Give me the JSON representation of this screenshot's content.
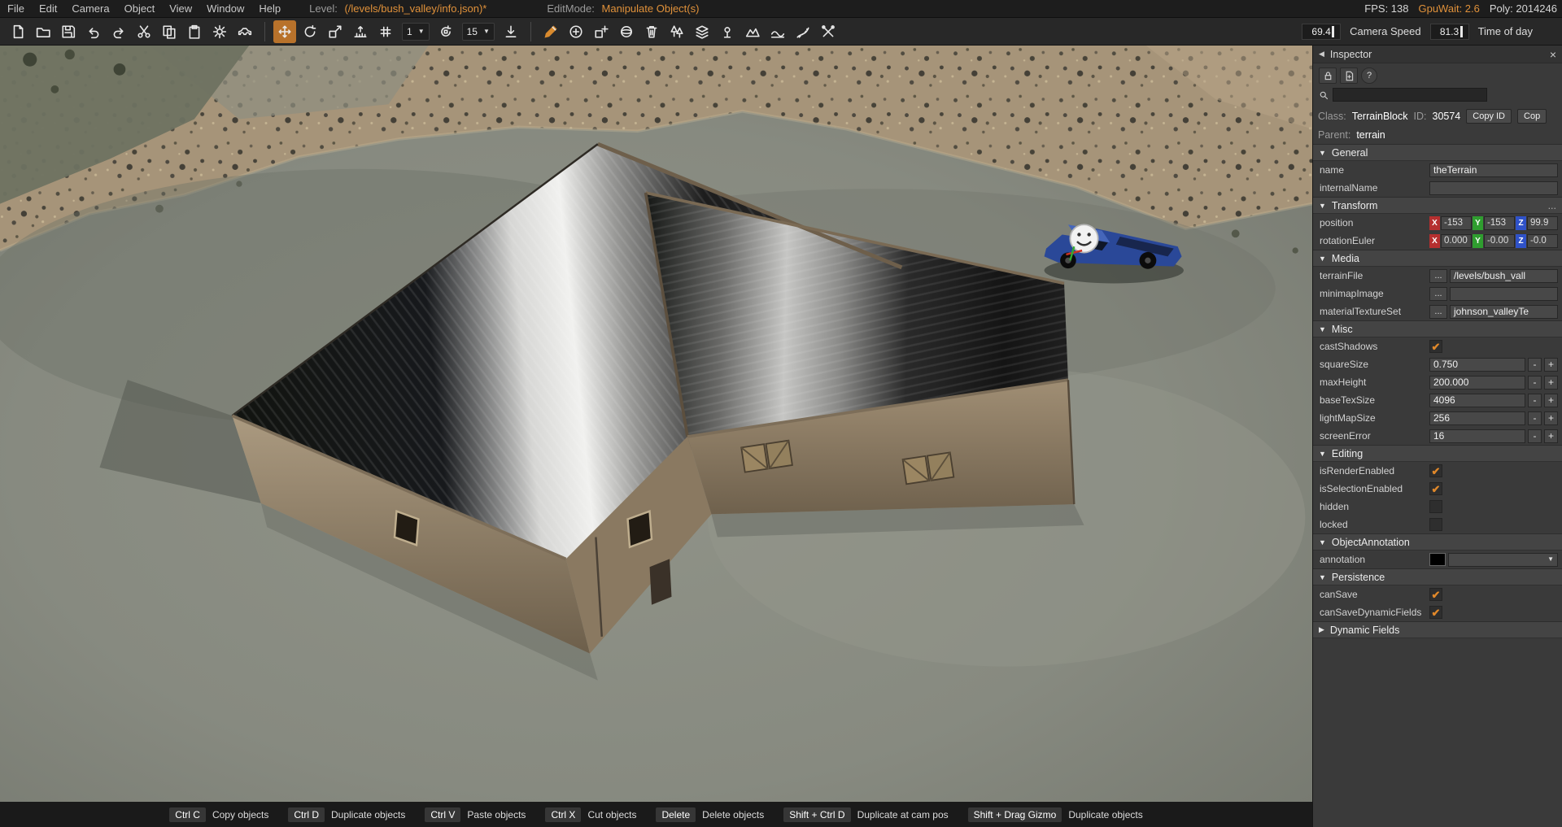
{
  "colors": {
    "accent": "#e0882a",
    "axis_x": "#b52f2f",
    "axis_y": "#2f9e2f",
    "axis_z": "#2f52c8"
  },
  "icons": {
    "check": "✔",
    "caret_down": "▼",
    "caret_right": "▶",
    "collapse_left": "◀",
    "close": "×",
    "help": "?"
  },
  "menubar": {
    "items": [
      "File",
      "Edit",
      "Camera",
      "Object",
      "View",
      "Window",
      "Help"
    ],
    "level_label": "Level:",
    "level_value": "(/levels/bush_valley/info.json)*",
    "editmode_label": "EditMode:",
    "editmode_value": "Manipulate Object(s)",
    "stats": {
      "fps": "FPS: 138",
      "gpuwait": "GpuWait: 2.6",
      "poly": "Poly: 2014246"
    }
  },
  "toolbar": {
    "icons": [
      "new-file",
      "open-folder",
      "save",
      "undo",
      "redo",
      "cut",
      "copy",
      "paste",
      "settings",
      "vehicle",
      "translate-tool",
      "rotate-tool",
      "scale-tool",
      "snap-tool",
      "grid-snap",
      "rotate-snap-tool",
      "drop-to-ground",
      "terrain-paint-brush",
      "add-circle",
      "add-object",
      "sphere-tool",
      "delete",
      "forest-tool",
      "layers-tool",
      "point-tool",
      "terrain-stamp",
      "terrain-smooth",
      "road-tool",
      "misc-tools"
    ],
    "snap_size_value": "1",
    "rotate_snap_value": "15",
    "camera_speed_value": "69.4",
    "camera_speed_label": "Camera Speed",
    "time_of_day_value": "81.3",
    "time_of_day_label": "Time of day"
  },
  "viewport": {
    "overlay_icons": [
      "vehicle-marker-smiley-icon",
      "axis-gizmo"
    ]
  },
  "inspector": {
    "title": "Inspector",
    "header_icons": [
      "lock-icon",
      "new-document-icon",
      "help-icon"
    ],
    "search_value": "",
    "class_label": "Class:",
    "class_value": "TerrainBlock",
    "id_label": "ID:",
    "id_value": "30574",
    "copy_id_button": "Copy ID",
    "copy_button_truncated": "Cop",
    "parent_label": "Parent:",
    "parent_value": "terrain",
    "browse_button": "...",
    "minus": "-",
    "plus": "+",
    "transform_more": "...",
    "axes": {
      "x": "X",
      "y": "Y",
      "z": "Z"
    },
    "section_headers": {
      "general": "General",
      "transform": "Transform",
      "media": "Media",
      "misc": "Misc",
      "editing": "Editing",
      "objectAnnotation": "ObjectAnnotation",
      "persistence": "Persistence",
      "dynamicFields": "Dynamic Fields"
    },
    "fields": {
      "name": {
        "label": "name",
        "value": "theTerrain"
      },
      "internalName": {
        "label": "internalName",
        "value": ""
      },
      "position": {
        "label": "position",
        "x": "-153",
        "y": "-153",
        "z": "99.9"
      },
      "rotationEuler": {
        "label": "rotationEuler",
        "x": "0.000",
        "y": "-0.00",
        "z": "-0.0"
      },
      "terrainFile": {
        "label": "terrainFile",
        "value": "/levels/bush_vall"
      },
      "minimapImage": {
        "label": "minimapImage",
        "value": ""
      },
      "materialTextureSet": {
        "label": "materialTextureSet",
        "value": "johnson_valleyTe"
      },
      "castShadows": {
        "label": "castShadows",
        "checked": true
      },
      "squareSize": {
        "label": "squareSize",
        "value": "0.750"
      },
      "maxHeight": {
        "label": "maxHeight",
        "value": "200.000"
      },
      "baseTexSize": {
        "label": "baseTexSize",
        "value": "4096"
      },
      "lightMapSize": {
        "label": "lightMapSize",
        "value": "256"
      },
      "screenError": {
        "label": "screenError",
        "value": "16"
      },
      "isRenderEnabled": {
        "label": "isRenderEnabled",
        "checked": true
      },
      "isSelectionEnabled": {
        "label": "isSelectionEnabled",
        "checked": true
      },
      "hidden": {
        "label": "hidden",
        "checked": false
      },
      "locked": {
        "label": "locked",
        "checked": false
      },
      "annotation": {
        "label": "annotation"
      },
      "canSave": {
        "label": "canSave",
        "checked": true
      },
      "canSaveDynamicFields": {
        "label": "canSaveDynamicFields",
        "checked": true
      }
    }
  },
  "statusbar": {
    "shortcuts": [
      {
        "keys": "Ctrl C",
        "action": "Copy objects"
      },
      {
        "keys": "Ctrl D",
        "action": "Duplicate objects"
      },
      {
        "keys": "Ctrl V",
        "action": "Paste objects"
      },
      {
        "keys": "Ctrl X",
        "action": "Cut objects"
      },
      {
        "keys": "Delete",
        "action": "Delete objects"
      },
      {
        "keys": "Shift + Ctrl D",
        "action": "Duplicate at cam pos"
      },
      {
        "keys": "Shift + Drag Gizmo",
        "action": "Duplicate objects"
      }
    ]
  }
}
